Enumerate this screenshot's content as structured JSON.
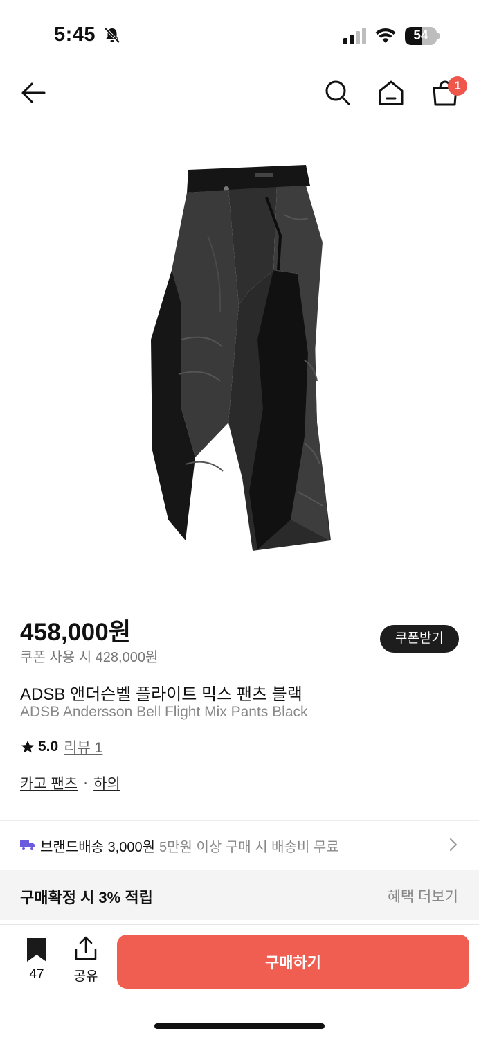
{
  "status_bar": {
    "time": "5:45",
    "battery_level": "54",
    "battery_fraction": 0.54,
    "icons": [
      "bell-slash-icon",
      "signal-icon",
      "wifi-icon",
      "battery-icon"
    ]
  },
  "nav": {
    "icons": [
      "back-arrow-icon",
      "search-icon",
      "home-icon",
      "shopping-bag-icon"
    ],
    "cart_badge": "1"
  },
  "product": {
    "price": "458,000원",
    "coupon_price": "쿠폰 사용 시 428,000원",
    "coupon_button": "쿠폰받기",
    "name_ko": "ADSB 앤더슨벨 플라이트 믹스 팬츠 블랙",
    "name_en": "ADSB Andersson Bell Flight Mix Pants Black",
    "rating": "5.0",
    "review_link": "리뷰 1",
    "categories": [
      "카고 팬츠",
      "하의"
    ],
    "category_sep": "·"
  },
  "shipping": {
    "label": "브랜드배송 3,000원",
    "condition": "5만원 이상 구매 시 배송비 무료"
  },
  "benefit": {
    "label": "구매확정 시 3% 적립",
    "more": "혜택 더보기"
  },
  "bottom_bar": {
    "bookmark_count": "47",
    "share_label": "공유",
    "buy_label": "구매하기"
  },
  "colors": {
    "accent": "#ef5e50",
    "badge": "#f0574c",
    "dark_button": "#1d1d1d",
    "shipping_truck": "#6a5ae0"
  }
}
